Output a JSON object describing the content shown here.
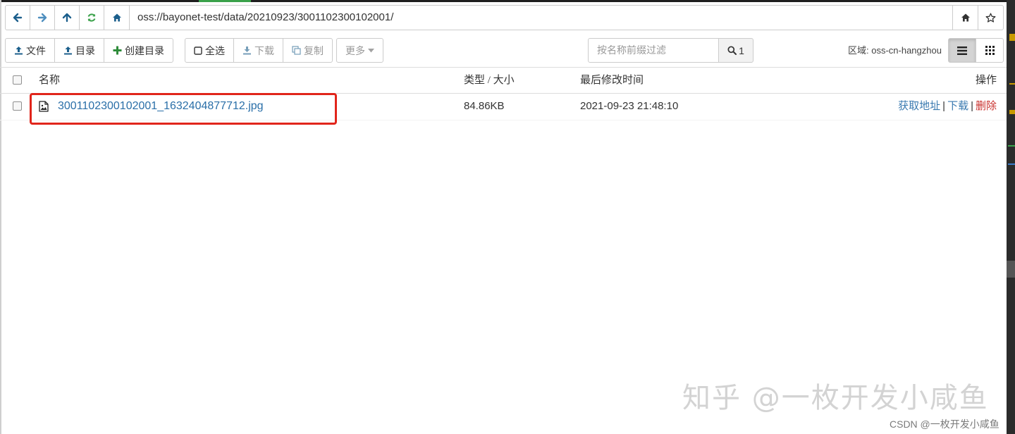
{
  "address_bar": {
    "path": "oss://bayonet-test/data/20210923/3001102300102001/"
  },
  "toolbar": {
    "upload_file": "文件",
    "upload_dir": "目录",
    "create_dir": "创建目录",
    "select_all": "全选",
    "download": "下载",
    "copy": "复制",
    "more": "更多",
    "search_placeholder": "按名称前缀过滤",
    "search_count": "1",
    "region": "区域: oss-cn-hangzhou"
  },
  "table": {
    "columns": [
      "名称",
      "类型 / 大小",
      "最后修改时间",
      "操作"
    ],
    "rows": [
      {
        "name": "3001102300102001_1632404877712.jpg",
        "size": "84.86KB",
        "modified": "2021-09-23 21:48:10",
        "actions": {
          "get_url": "获取地址",
          "download": "下载",
          "delete": "删除"
        }
      }
    ]
  },
  "watermark": "知乎 @一枚开发小咸鱼",
  "credit": "CSDN @一枚开发小咸鱼",
  "colors": {
    "link": "#2a6fa8",
    "danger": "#c9302c",
    "highlight": "#e1251b",
    "icon": "#1c5f8c"
  }
}
